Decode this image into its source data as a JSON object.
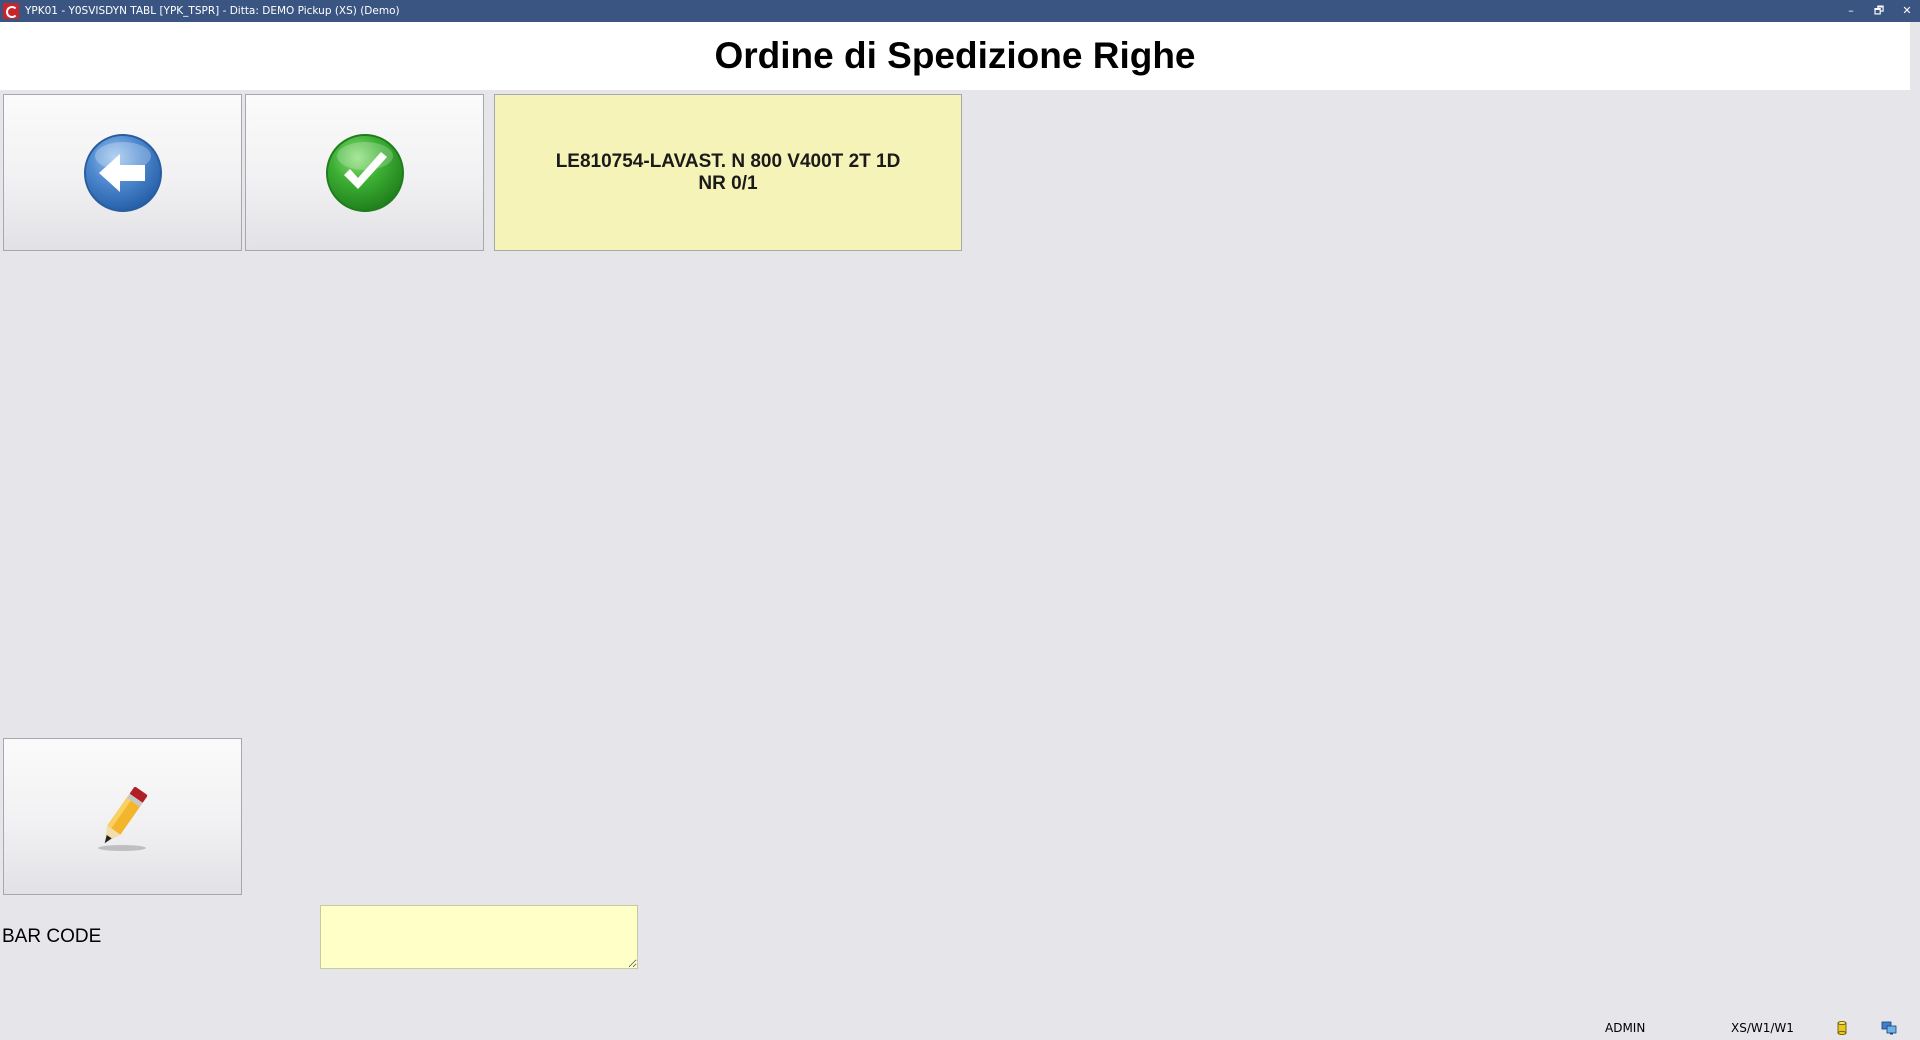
{
  "window": {
    "title": "YPK01 - Y0SVISDYN TABL [YPK_TSPR] - Ditta: DEMO Pickup (XS)  (Demo)",
    "controls": {
      "minimize": "–",
      "restore": "🗗",
      "close": "✕"
    }
  },
  "header": {
    "title": "Ordine di Spedizione Righe"
  },
  "toolbar": {
    "back_icon": "arrow-left-icon",
    "confirm_icon": "checkmark-icon",
    "edit_icon": "pencil-icon"
  },
  "info": {
    "line1": "LE810754-LAVAST. N 800 V400T 2T 1D",
    "line2": "NR 0/1"
  },
  "barcode": {
    "label": "BAR CODE",
    "value": ""
  },
  "statusbar": {
    "user": "ADMIN",
    "environment": "XS/W1/W1"
  },
  "colors": {
    "titlebar": "#3b5583",
    "background": "#e6e5ea",
    "info_panel": "#f5f3b8",
    "input_bg": "#ffffc8"
  }
}
